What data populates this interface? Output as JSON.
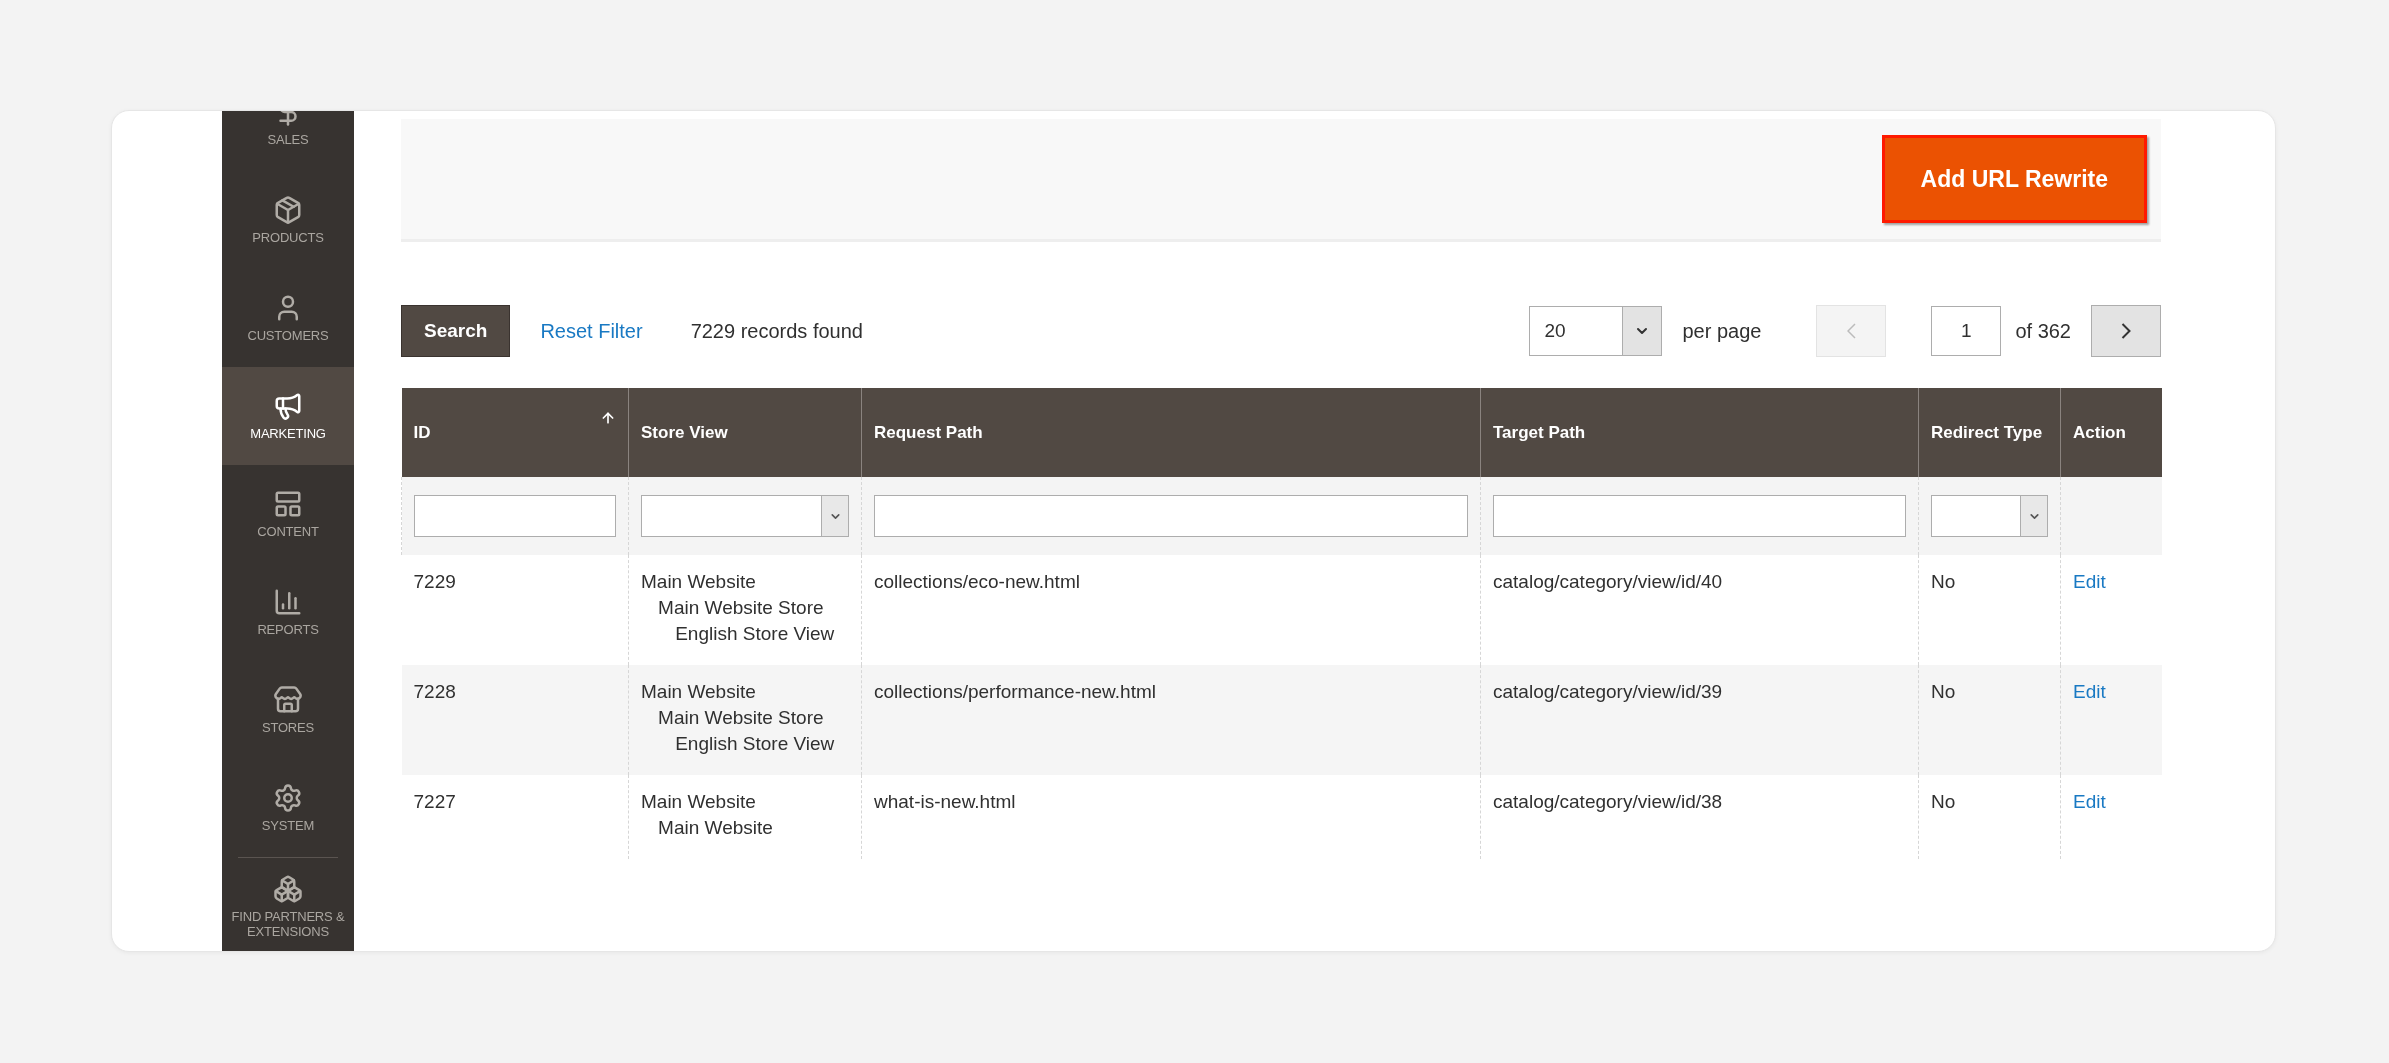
{
  "sidebar": {
    "items": [
      {
        "label": "SALES",
        "selected": false
      },
      {
        "label": "PRODUCTS",
        "selected": false
      },
      {
        "label": "CUSTOMERS",
        "selected": false
      },
      {
        "label": "MARKETING",
        "selected": true
      },
      {
        "label": "CONTENT",
        "selected": false
      },
      {
        "label": "REPORTS",
        "selected": false
      },
      {
        "label": "STORES",
        "selected": false
      },
      {
        "label": "SYSTEM",
        "selected": false
      },
      {
        "label": "FIND PARTNERS & EXTENSIONS",
        "selected": false
      }
    ]
  },
  "page_actions": {
    "add_button": "Add URL Rewrite"
  },
  "grid_toolbar": {
    "search_button": "Search",
    "reset_filter": "Reset Filter",
    "records": "7229 records found",
    "per_page_value": "20",
    "per_page_label": "per page",
    "prev_disabled": true,
    "page": "1",
    "page_total": "of 362"
  },
  "table": {
    "columns": [
      {
        "label": "ID",
        "sorted": true
      },
      {
        "label": "Store View",
        "sorted": false
      },
      {
        "label": "Request Path",
        "sorted": false
      },
      {
        "label": "Target Path",
        "sorted": false
      },
      {
        "label": "Redirect Type",
        "sorted": false
      },
      {
        "label": "Action",
        "sorted": false
      }
    ],
    "filters": [
      {
        "kind": "text"
      },
      {
        "kind": "select"
      },
      {
        "kind": "text"
      },
      {
        "kind": "text"
      },
      {
        "kind": "select"
      },
      {
        "kind": "none"
      }
    ],
    "rows": [
      {
        "id": "7229",
        "store_view": [
          "Main Website",
          "Main Website Store",
          "English Store View"
        ],
        "request_path": "collections/eco-new.html",
        "target_path": "catalog/category/view/id/40",
        "redirect_type": "No",
        "action": "Edit"
      },
      {
        "id": "7228",
        "store_view": [
          "Main Website",
          "Main Website Store",
          "English Store View"
        ],
        "request_path": "collections/performance-new.html",
        "target_path": "catalog/category/view/id/39",
        "redirect_type": "No",
        "action": "Edit"
      },
      {
        "id": "7227",
        "store_view": [
          "Main Website",
          "Main Website"
        ],
        "request_path": "what-is-new.html",
        "target_path": "catalog/category/view/id/38",
        "redirect_type": "No",
        "action": "Edit"
      }
    ]
  }
}
